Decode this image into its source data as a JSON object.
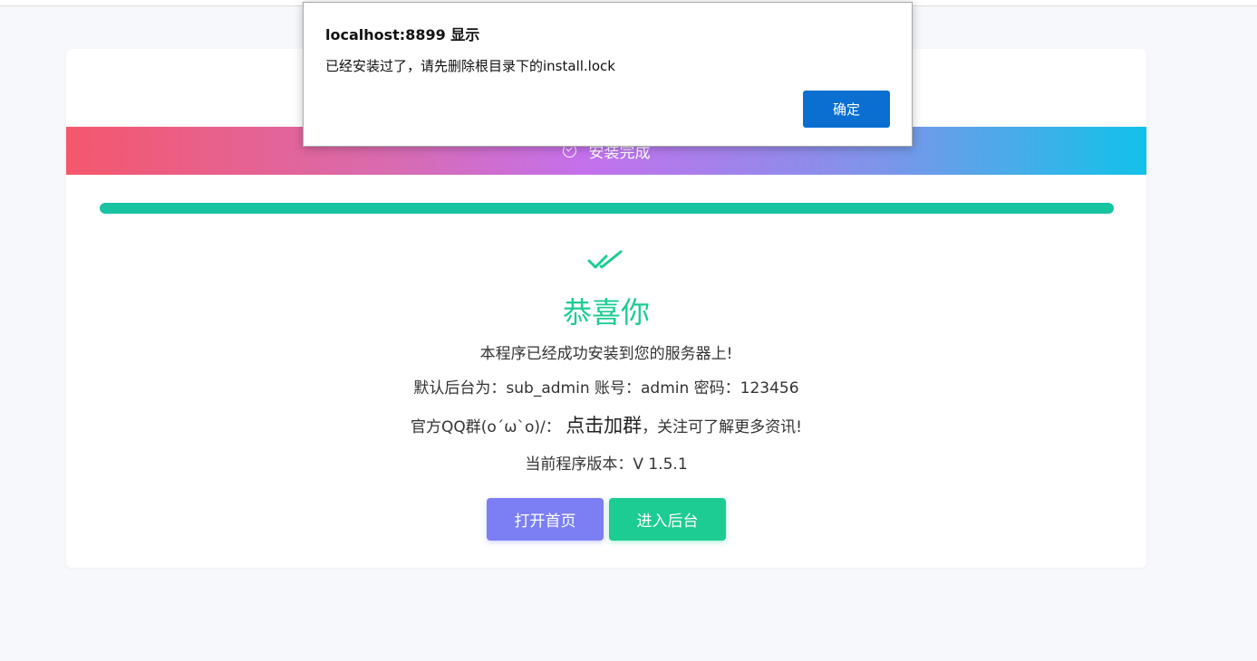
{
  "banner": {
    "label": "安装完成",
    "icon": "check-circle-icon"
  },
  "progress": {
    "percent": 100
  },
  "success": {
    "icon": "double-check-icon",
    "title": "恭喜你",
    "installed_msg": "本程序已经成功安装到您的服务器上!",
    "default_admin": "默认后台为：sub_admin 账号：admin 密码：123456",
    "qq_prefix": "官方QQ群(o´ω`o)/：",
    "qq_link": "点击加群",
    "qq_suffix": "，关注可了解更多资讯!",
    "version": "当前程序版本：V 1.5.1"
  },
  "buttons": {
    "home": "打开首页",
    "admin": "进入后台"
  },
  "dialog": {
    "title": "localhost:8899 显示",
    "message": "已经安装过了，请先删除根目录下的install.lock",
    "ok": "确定"
  },
  "colors": {
    "accent_green": "#1ccc92",
    "accent_purple": "#7b7ff3",
    "dialog_button": "#0a6fd1"
  }
}
